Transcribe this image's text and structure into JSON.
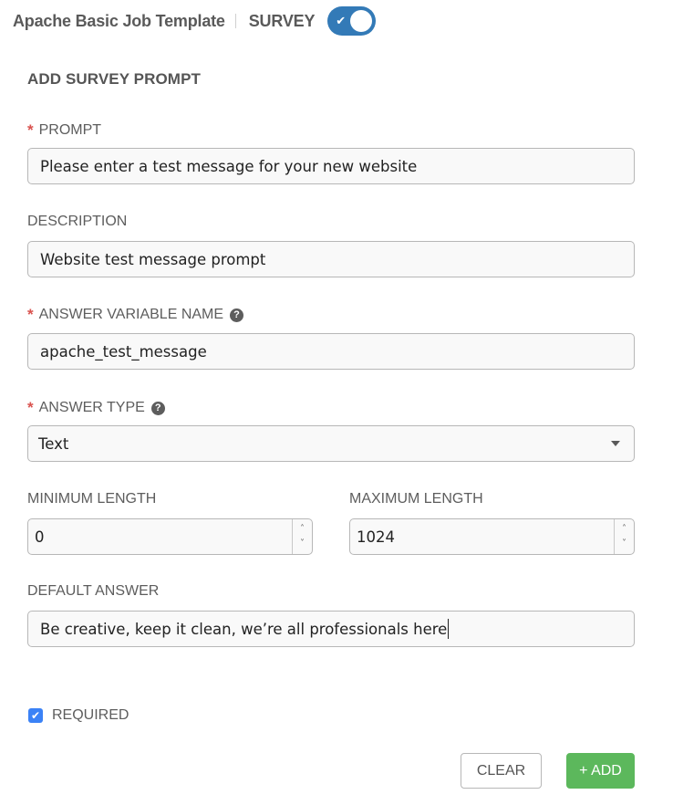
{
  "header": {
    "breadcrumb_template": "Apache Basic Job Template",
    "breadcrumb_section": "SURVEY",
    "survey_toggle": {
      "enabled": true,
      "icon": "check-icon"
    }
  },
  "form": {
    "title": "ADD SURVEY PROMPT",
    "required_marker": "*",
    "help_glyph": "?",
    "prompt": {
      "label": "PROMPT",
      "required": true,
      "value": "Please enter a test message for your new website"
    },
    "description": {
      "label": "DESCRIPTION",
      "required": false,
      "value": "Website test message prompt"
    },
    "answer_variable_name": {
      "label": "ANSWER VARIABLE NAME",
      "required": true,
      "help": true,
      "value": "apache_test_message"
    },
    "answer_type": {
      "label": "ANSWER TYPE",
      "required": true,
      "help": true,
      "selected": "Text"
    },
    "minimum_length": {
      "label": "MINIMUM LENGTH",
      "value": "0"
    },
    "maximum_length": {
      "label": "MAXIMUM LENGTH",
      "value": "1024"
    },
    "default_answer": {
      "label": "DEFAULT ANSWER",
      "value": "Be creative, keep it clean, we’re all professionals here"
    },
    "required_checkbox": {
      "label": "REQUIRED",
      "checked": true,
      "glyph": "✔"
    },
    "spinner_up": "˄",
    "spinner_down": "˅"
  },
  "buttons": {
    "clear": "CLEAR",
    "add": "+ ADD"
  },
  "colors": {
    "primary": "#337ab7",
    "success": "#5cb85c",
    "required": "#d9534f",
    "checkbox": "#3b82f6"
  }
}
